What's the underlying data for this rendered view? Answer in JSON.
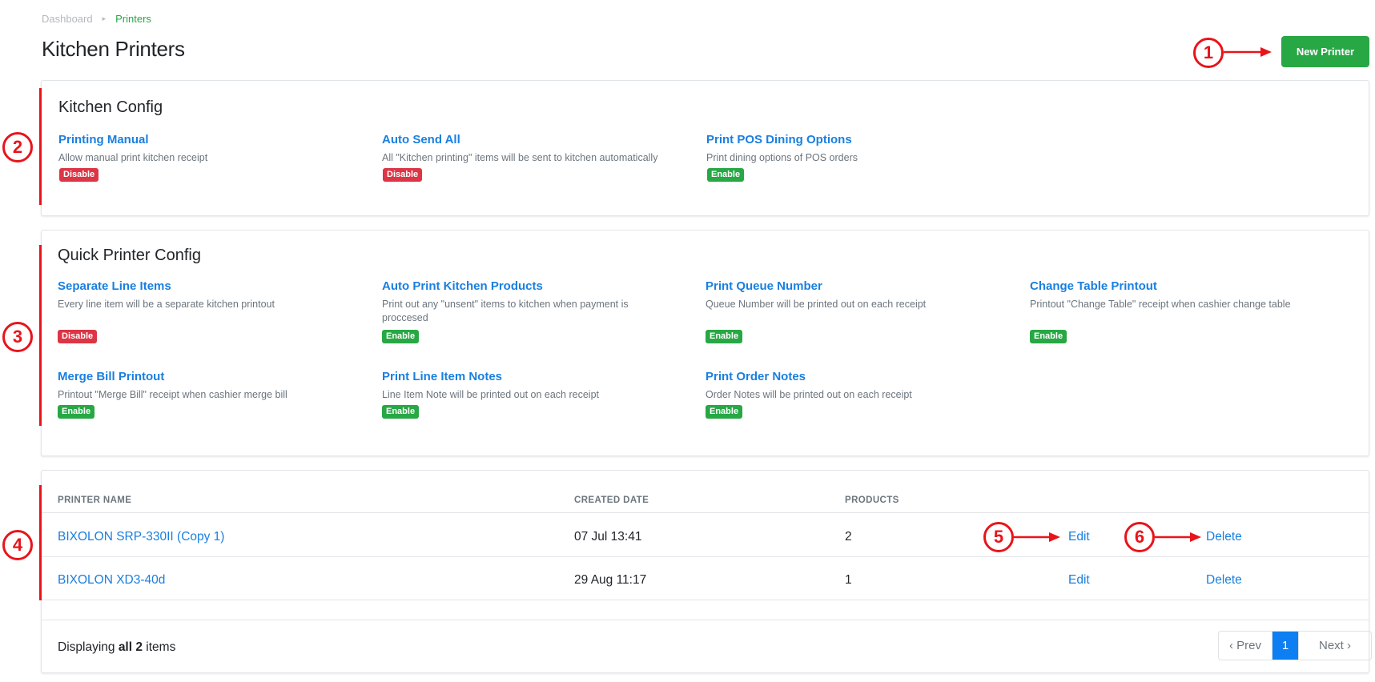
{
  "breadcrumb": {
    "dashboard": "Dashboard",
    "separator": "▸",
    "current": "Printers"
  },
  "page_title": "Kitchen Printers",
  "new_printer_button": "New Printer",
  "kitchen_config": {
    "title": "Kitchen Config",
    "options": [
      {
        "title": "Printing Manual",
        "desc": "Allow manual print kitchen receipt",
        "status": "Disable"
      },
      {
        "title": "Auto Send All",
        "desc": "All \"Kitchen printing\" items will be sent to kitchen automatically",
        "status": "Disable"
      },
      {
        "title": "Print POS Dining Options",
        "desc": "Print dining options of POS orders",
        "status": "Enable"
      }
    ]
  },
  "quick_config": {
    "title": "Quick Printer Config",
    "options": [
      {
        "title": "Separate Line Items",
        "desc": "Every line item will be a separate kitchen printout",
        "status": "Disable"
      },
      {
        "title": "Auto Print Kitchen Products",
        "desc": "Print out any \"unsent\" items to kitchen when payment is proccesed",
        "status": "Enable"
      },
      {
        "title": "Print Queue Number",
        "desc": "Queue Number will be printed out on each receipt",
        "status": "Enable"
      },
      {
        "title": "Change Table Printout",
        "desc": "Printout \"Change Table\" receipt when cashier change table",
        "status": "Enable"
      },
      {
        "title": "Merge Bill Printout",
        "desc": "Printout \"Merge Bill\" receipt when cashier merge bill",
        "status": "Enable"
      },
      {
        "title": "Print Line Item Notes",
        "desc": "Line Item Note will be printed out on each receipt",
        "status": "Enable"
      },
      {
        "title": "Print Order Notes",
        "desc": "Order Notes will be printed out on each receipt",
        "status": "Enable"
      }
    ]
  },
  "printers_table": {
    "headers": [
      "PRINTER NAME",
      "CREATED DATE",
      "PRODUCTS"
    ],
    "rows": [
      {
        "name": "BIXOLON SRP-330II (Copy 1)",
        "created": "07 Jul 13:41",
        "products": "2",
        "edit": "Edit",
        "delete": "Delete"
      },
      {
        "name": "BIXOLON XD3-40d",
        "created": "29 Aug 11:17",
        "products": "1",
        "edit": "Edit",
        "delete": "Delete"
      }
    ],
    "footer": {
      "prefix": "Displaying ",
      "bold": "all 2",
      "suffix": " items"
    },
    "pagination": {
      "prev": "‹ Prev",
      "current": "1",
      "next": "Next ›"
    }
  },
  "annotations": [
    "1",
    "2",
    "3",
    "4",
    "5",
    "6"
  ],
  "colors": {
    "accent_green": "#28a745",
    "link_blue": "#1a7fe0",
    "danger_red": "#dc3545",
    "annotation_red": "#e8141a",
    "page_active": "#0d7ff2"
  }
}
